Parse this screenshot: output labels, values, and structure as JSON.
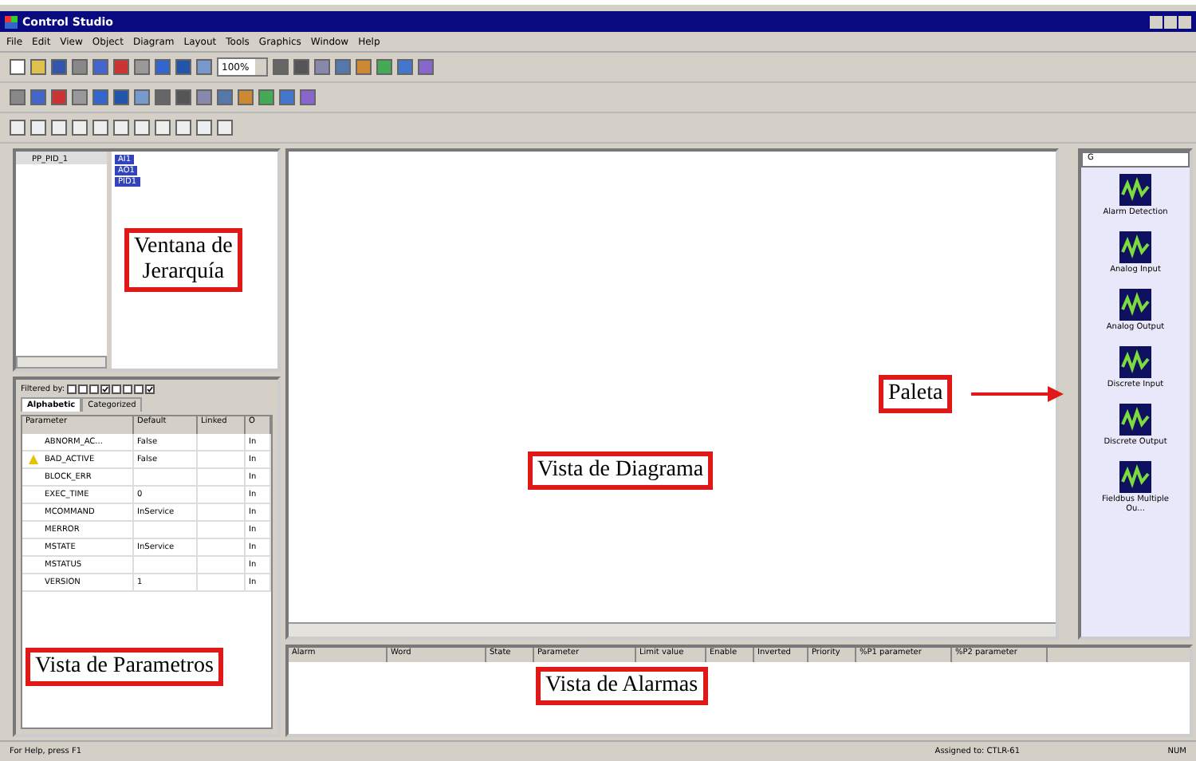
{
  "window": {
    "title": "Control Studio"
  },
  "menu": [
    "File",
    "Edit",
    "View",
    "Object",
    "Diagram",
    "Layout",
    "Tools",
    "Graphics",
    "Window",
    "Help"
  ],
  "toolbar": {
    "zoom": "100%"
  },
  "hierarchy": {
    "tree": [
      {
        "label": "PP_PID_1",
        "expanded": true,
        "children": [
          {
            "label": "AI1"
          },
          {
            "label": "AO1"
          },
          {
            "label": "PID1"
          }
        ]
      }
    ]
  },
  "parameters": {
    "filter_label": "Filtered by:",
    "filters": [
      {
        "checked": false
      },
      {
        "checked": false
      },
      {
        "checked": false
      },
      {
        "checked": true
      },
      {
        "checked": false
      },
      {
        "checked": false
      },
      {
        "checked": false
      },
      {
        "checked": true
      }
    ],
    "tabs": [
      {
        "label": "Alphabetic",
        "selected": true
      },
      {
        "label": "Categorized",
        "selected": false
      }
    ],
    "columns": [
      "Parameter",
      "Default",
      "Linked",
      "O"
    ],
    "rows": [
      {
        "cells": [
          "ABNORM_AC...",
          "False",
          "",
          "In"
        ],
        "warning": false
      },
      {
        "cells": [
          "BAD_ACTIVE",
          "False",
          "",
          "In"
        ],
        "warning": true
      },
      {
        "cells": [
          "BLOCK_ERR",
          "",
          "",
          "In"
        ],
        "warning": false
      },
      {
        "cells": [
          "EXEC_TIME",
          "0",
          "",
          "In"
        ],
        "warning": false
      },
      {
        "cells": [
          "MCOMMAND",
          "InService",
          "",
          "In"
        ],
        "warning": false
      },
      {
        "cells": [
          "MERROR",
          "",
          "",
          "In"
        ],
        "warning": false
      },
      {
        "cells": [
          "MSTATE",
          "InService",
          "",
          "In"
        ],
        "warning": false
      },
      {
        "cells": [
          "MSTATUS",
          "",
          "",
          "In"
        ],
        "warning": false
      },
      {
        "cells": [
          "VERSION",
          "1",
          "",
          "In"
        ],
        "warning": false
      }
    ]
  },
  "palette": {
    "search": "G",
    "items": [
      "Alarm Detection",
      "Analog Input",
      "Analog Output",
      "Discrete Input",
      "Discrete Output",
      "Fieldbus Multiple Ou..."
    ]
  },
  "alarms": {
    "columns": [
      "Alarm",
      "Word",
      "State",
      "Parameter",
      "Limit value",
      "Enable",
      "Inverted",
      "Priority",
      "%P1 parameter",
      "%P2 parameter"
    ]
  },
  "annotations": [
    {
      "kind": "hierarchy",
      "lines": [
        "Ventana de",
        "Jerarquía"
      ]
    },
    {
      "kind": "parameters",
      "lines": [
        "Vista de Parametros"
      ]
    },
    {
      "kind": "diagram",
      "lines": [
        "Vista de Diagrama"
      ]
    },
    {
      "kind": "palette",
      "lines": [
        "Paleta"
      ]
    },
    {
      "kind": "alarms",
      "lines": [
        "Vista de Alarmas"
      ]
    }
  ],
  "status_bar": {
    "help": "For Help, press F1",
    "assigned": "Assigned to: CTLR-61",
    "num": "NUM"
  }
}
